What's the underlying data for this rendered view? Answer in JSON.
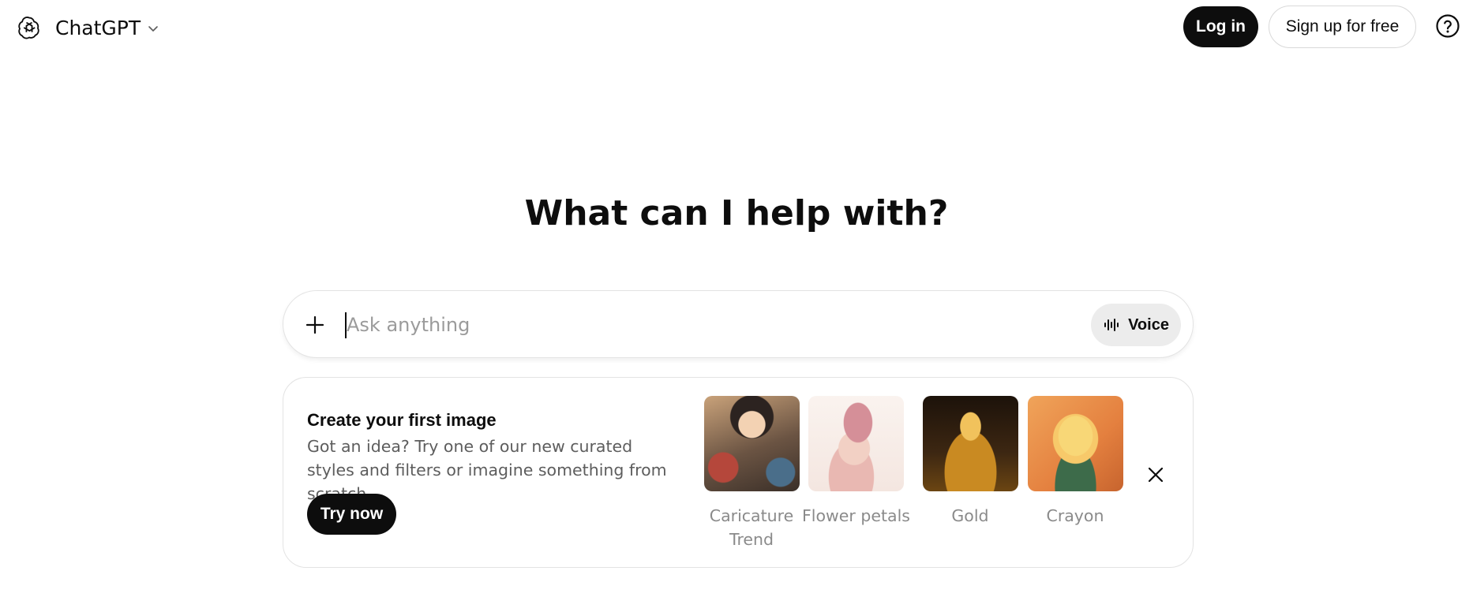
{
  "header": {
    "model_name": "ChatGPT",
    "login_label": "Log in",
    "signup_label": "Sign up for free",
    "icons": [
      "openai-logo-icon",
      "chevron-down-icon",
      "help-icon"
    ]
  },
  "main": {
    "headline": "What can I help with?"
  },
  "composer": {
    "placeholder": "Ask anything",
    "voice_label": "Voice",
    "icons": [
      "plus-icon",
      "voice-waveform-icon"
    ]
  },
  "promo": {
    "title": "Create your first image",
    "description": "Got an idea? Try one of our new curated styles and filters or imagine something from scratch.",
    "try_label": "Try now",
    "styles": [
      {
        "label": "Caricature Trend"
      },
      {
        "label": "Flower petals"
      },
      {
        "label": "Gold"
      },
      {
        "label": "Crayon"
      }
    ],
    "close_icon": "close-icon"
  }
}
